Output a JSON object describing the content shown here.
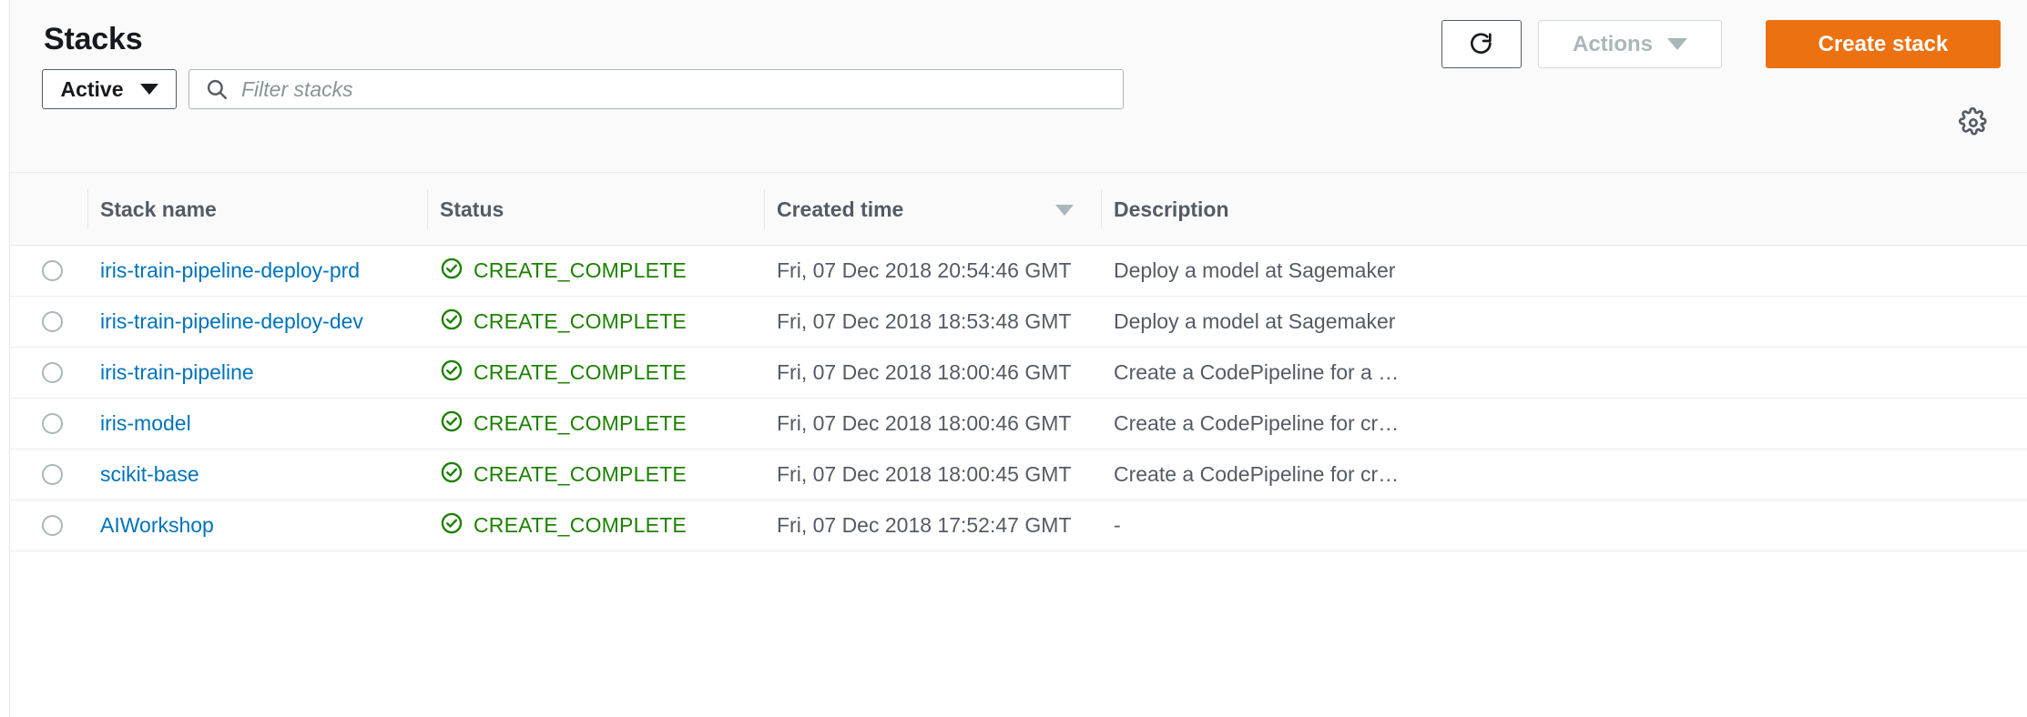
{
  "header": {
    "title": "Stacks",
    "refresh_icon": "refresh-icon",
    "actions_label": "Actions",
    "actions_caret_icon": "chevron-down-icon",
    "create_label": "Create stack"
  },
  "filters": {
    "status_filter_value": "Active",
    "status_filter_caret_icon": "chevron-down-icon",
    "search_icon": "search-icon",
    "search_placeholder": "Filter stacks",
    "search_value": "",
    "settings_icon": "gear-icon"
  },
  "table": {
    "columns": [
      {
        "key": "select",
        "label": ""
      },
      {
        "key": "name",
        "label": "Stack name"
      },
      {
        "key": "status",
        "label": "Status"
      },
      {
        "key": "time",
        "label": "Created time"
      },
      {
        "key": "description",
        "label": "Description"
      }
    ],
    "sorted_column": "Created time",
    "sort_caret_icon": "chevron-down-icon",
    "status_icon": "check-circle-icon",
    "rows": [
      {
        "selected": false,
        "name": "iris-train-pipeline-deploy-prd",
        "status": "CREATE_COMPLETE",
        "created_time": "Fri, 07 Dec 2018 20:54:46 GMT",
        "description": "Deploy a model at Sagemaker"
      },
      {
        "selected": false,
        "name": "iris-train-pipeline-deploy-dev",
        "status": "CREATE_COMPLETE",
        "created_time": "Fri, 07 Dec 2018 18:53:48 GMT",
        "description": "Deploy a model at Sagemaker"
      },
      {
        "selected": false,
        "name": "iris-train-pipeline",
        "status": "CREATE_COMPLETE",
        "created_time": "Fri, 07 Dec 2018 18:00:46 GMT",
        "description": "Create a CodePipeline for a Mac…"
      },
      {
        "selected": false,
        "name": "iris-model",
        "status": "CREATE_COMPLETE",
        "created_time": "Fri, 07 Dec 2018 18:00:46 GMT",
        "description": "Create a CodePipeline for creatin…"
      },
      {
        "selected": false,
        "name": "scikit-base",
        "status": "CREATE_COMPLETE",
        "created_time": "Fri, 07 Dec 2018 18:00:45 GMT",
        "description": "Create a CodePipeline for creatin…"
      },
      {
        "selected": false,
        "name": "AIWorkshop",
        "status": "CREATE_COMPLETE",
        "created_time": "Fri, 07 Dec 2018 17:52:47 GMT",
        "description": "-"
      }
    ]
  },
  "colors": {
    "accent_orange": "#ec7211",
    "link_blue": "#0073bb",
    "status_green": "#1d8102",
    "text_dark": "#16191f",
    "text_muted": "#545b64",
    "disabled_gray": "#aab7b8"
  }
}
